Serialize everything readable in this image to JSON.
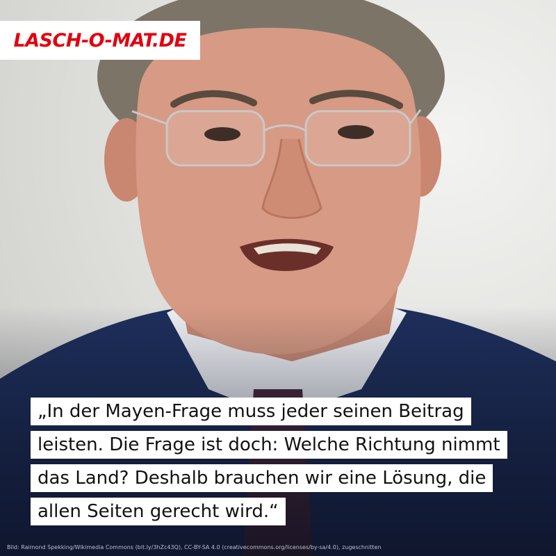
{
  "brand": {
    "name": "LASCH-O-MAT.DE",
    "color": "#e3000f"
  },
  "quote": {
    "lines": [
      "„In der Mayen-Frage muss jeder seinen Beitrag",
      "leisten. Die Frage ist doch: Welche Richtung nimmt",
      "das Land? Deshalb brauchen wir eine Lösung, die",
      "allen Seiten gerecht wird.“"
    ]
  },
  "image_credit": "Bild: Raimond Spekking/Wikimedia Commons (bit.ly/3hZc43Q), CC-BY-SA 4.0 (creativecommons.org/licenses/by-sa/4.0), zugeschnitten",
  "colors": {
    "suit": "#1e2f5c",
    "background": "#e2e2df",
    "quote_box": "#ffffff"
  }
}
